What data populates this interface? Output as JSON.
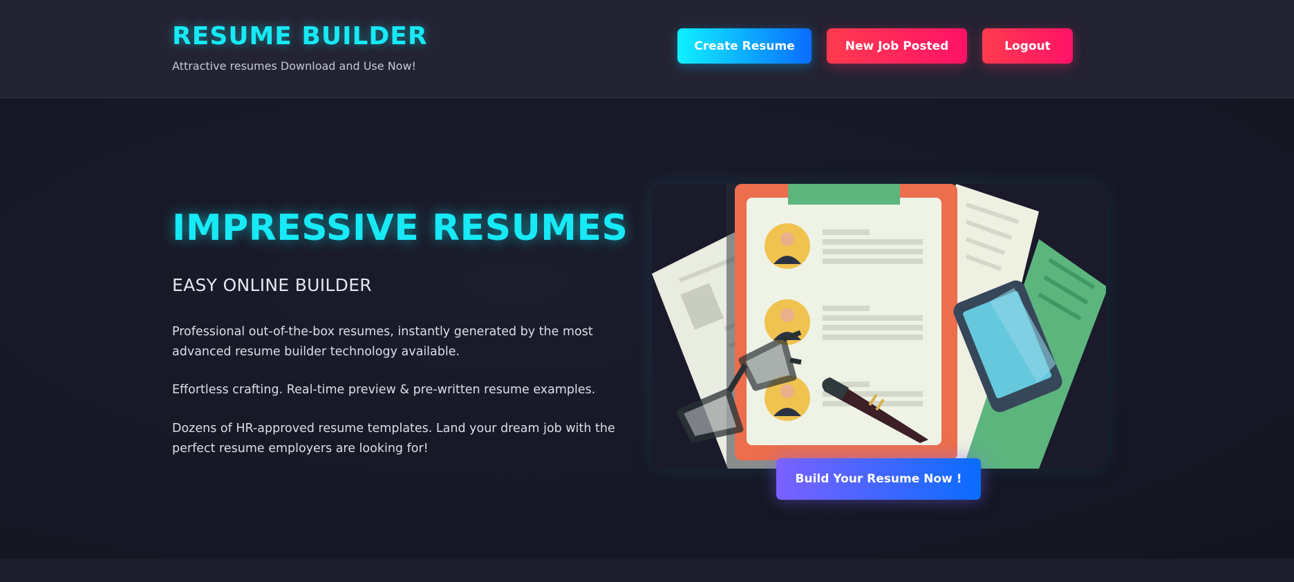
{
  "header": {
    "brand_title": "RESUME BUILDER",
    "tagline": "Attractive resumes Download and Use Now!",
    "nav": {
      "create_resume": "Create Resume",
      "new_job_posted": "New Job Posted",
      "logout": "Logout"
    }
  },
  "hero": {
    "title": "IMPRESSIVE RESUMES",
    "subtitle": "EASY ONLINE BUILDER",
    "paragraphs": [
      "Professional out-of-the-box resumes, instantly generated by the most advanced resume builder technology available.",
      "Effortless crafting. Real-time preview & pre-written resume examples.",
      "Dozens of HR-approved resume templates. Land your dream job with the perfect resume employers are looking for!"
    ],
    "cta_label": "Build Your Resume Now !",
    "illustration": "resume-clipboard-illustration"
  },
  "colors": {
    "accent_cyan": "#17e9f5",
    "primary_gradient": [
      "#0ff0ff",
      "#0a6cff"
    ],
    "danger_gradient": [
      "#ff3b4f",
      "#ff1267"
    ],
    "cta_gradient": [
      "#7b61ff",
      "#0a6cff"
    ],
    "background": "#161624"
  }
}
